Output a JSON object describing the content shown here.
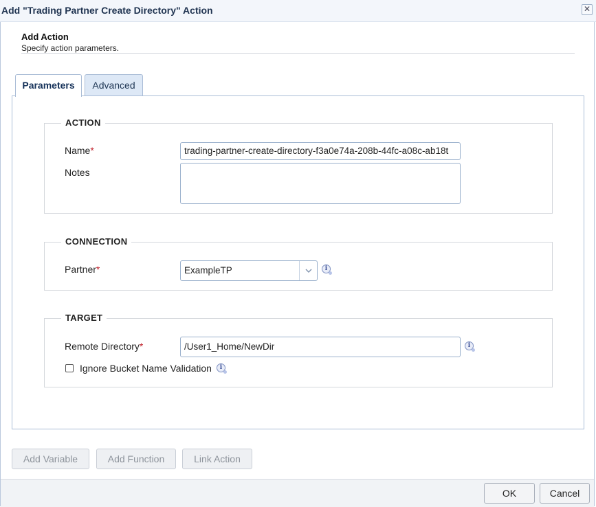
{
  "window": {
    "title": "Add \"Trading Partner Create Directory\" Action",
    "close_glyph": "✕"
  },
  "header": {
    "title": "Add Action",
    "subtitle": "Specify action parameters."
  },
  "tabs": [
    {
      "label": "Parameters",
      "active": true
    },
    {
      "label": "Advanced",
      "active": false
    }
  ],
  "action_group": {
    "legend": "ACTION",
    "name_label": "Name",
    "name_value": "trading-partner-create-directory-f3a0e74a-208b-44fc-a08c-ab18t",
    "notes_label": "Notes",
    "notes_value": ""
  },
  "connection_group": {
    "legend": "CONNECTION",
    "partner_label": "Partner",
    "partner_value": "ExampleTP"
  },
  "target_group": {
    "legend": "TARGET",
    "remote_dir_label": "Remote Directory",
    "remote_dir_value": "/User1_Home/NewDir",
    "ignore_bucket_label": "Ignore Bucket Name Validation",
    "ignore_bucket_checked": false
  },
  "required_marker": "*",
  "toolbar": {
    "add_variable": "Add Variable",
    "add_function": "Add Function",
    "link_action": "Link Action"
  },
  "footer": {
    "ok": "OK",
    "cancel": "Cancel"
  },
  "icons": {
    "info": "info-icon",
    "close": "close-icon",
    "dropdown": "chevron-down-icon"
  }
}
